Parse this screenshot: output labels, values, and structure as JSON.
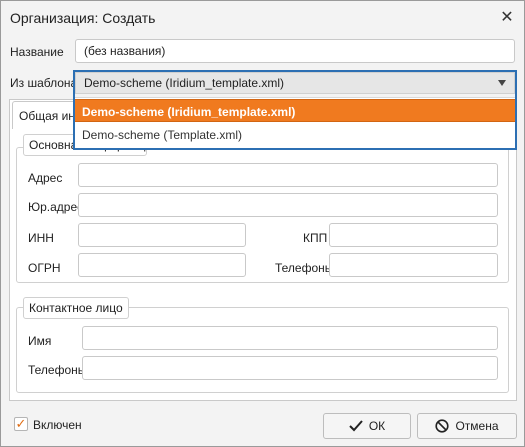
{
  "dialog": {
    "title": "Организация: Создать",
    "close_glyph": "✕"
  },
  "form": {
    "name_label": "Название",
    "name_value": "(без названия)",
    "template_label": "Из шаблона",
    "template_value": "Demo-scheme (Iridium_template.xml)",
    "template_options": [
      {
        "label": "Demo-scheme (Iridium_template.xml)",
        "selected": true
      },
      {
        "label": "Demo-scheme (Template.xml)",
        "selected": false
      }
    ]
  },
  "tabs": [
    {
      "label": "Общая информация",
      "active": true
    }
  ],
  "main_info": {
    "legend": "Основная информация",
    "address_label": "Адрес",
    "address_value": "",
    "legal_address_label": "Юр.адрес",
    "legal_address_value": "",
    "inn_label": "ИНН",
    "inn_value": "",
    "kpp_label": "КПП",
    "kpp_value": "",
    "ogrn_label": "ОГРН",
    "ogrn_value": "",
    "phones_label": "Телефоны",
    "phones_value": ""
  },
  "contact": {
    "legend": "Контактное лицо",
    "name_label": "Имя",
    "name_value": "",
    "phones_label": "Телефоны",
    "phones_value": ""
  },
  "footer": {
    "enabled_label": "Включен",
    "enabled_checked": true,
    "check_glyph": "✓",
    "ok_label": "ОК",
    "ok_icon": "check-icon",
    "cancel_label": "Отмена",
    "cancel_icon": "no-entry-icon"
  },
  "colors": {
    "accent_selected": "#f07a1f",
    "focus_frame": "#2c6fb3"
  }
}
